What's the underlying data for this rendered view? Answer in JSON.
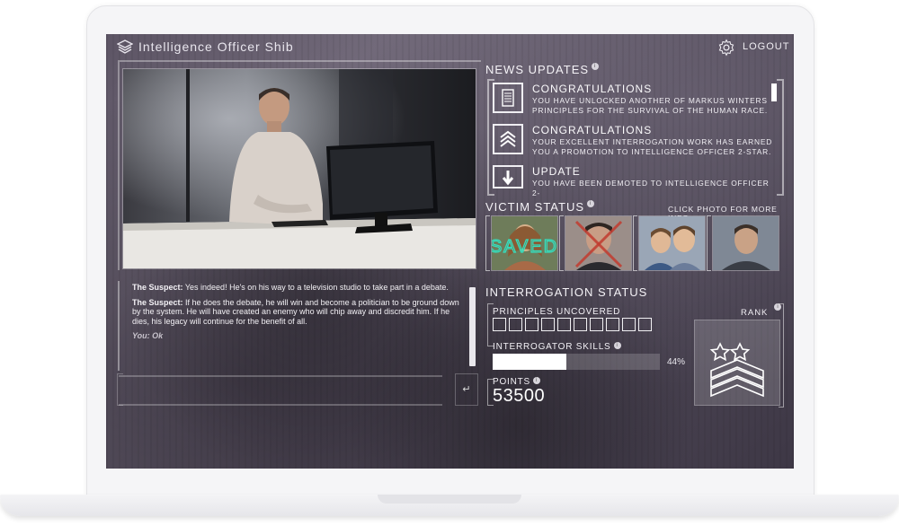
{
  "app": {
    "title": "Intelligence Officer Shib",
    "logout_label": "LOGOUT"
  },
  "chat": {
    "messages": [
      {
        "speaker": "The Suspect:",
        "text": " Yes indeed! He's on his way to a television studio to take part in a debate."
      },
      {
        "speaker": "The Suspect:",
        "text": " If he does the debate, he will win and become a politician to be ground down by the system. He will have created an enemy who will chip away and discredit him. If he dies, his legacy will continue for the benefit of all."
      }
    ],
    "you_line": "You: Ok",
    "send_icon": "return-arrow-icon"
  },
  "news": {
    "title": "NEWS UPDATES",
    "items": [
      {
        "icon": "document-icon",
        "heading": "CONGRATULATIONS",
        "text": "YOU HAVE UNLOCKED ANOTHER OF MARKUS WINTERS PRINCIPLES FOR THE SURVIVAL OF THE HUMAN RACE."
      },
      {
        "icon": "chevrons-up-icon",
        "heading": "CONGRATULATIONS",
        "text": "YOUR EXCELLENT INTERROGATION WORK HAS EARNED YOU A PROMOTION TO INTELLIGENCE OFFICER 2-STAR."
      },
      {
        "icon": "arrow-down-icon",
        "heading": "UPDATE",
        "text": "YOU HAVE BEEN DEMOTED TO INTELLIGENCE OFFICER 2-"
      }
    ]
  },
  "victims": {
    "title": "VICTIM STATUS",
    "hint": "CLICK PHOTO FOR MORE INFO",
    "photos": [
      {
        "status": "saved",
        "overlay": "SAVED"
      },
      {
        "status": "dead",
        "overlay": ""
      },
      {
        "status": "unknown",
        "overlay": ""
      },
      {
        "status": "unknown",
        "overlay": ""
      }
    ]
  },
  "interrogation": {
    "title": "INTERROGATION STATUS",
    "principles_label": "PRINCIPLES UNCOVERED",
    "principles_total": 10,
    "principles_uncovered": 0,
    "skills_label": "INTERROGATOR SKILLS",
    "skills_value": 44,
    "skills_pct_text": "44%",
    "points_label": "POINTS",
    "points_value": "53500",
    "rank_label": "RANK",
    "rank_stars": 2
  }
}
